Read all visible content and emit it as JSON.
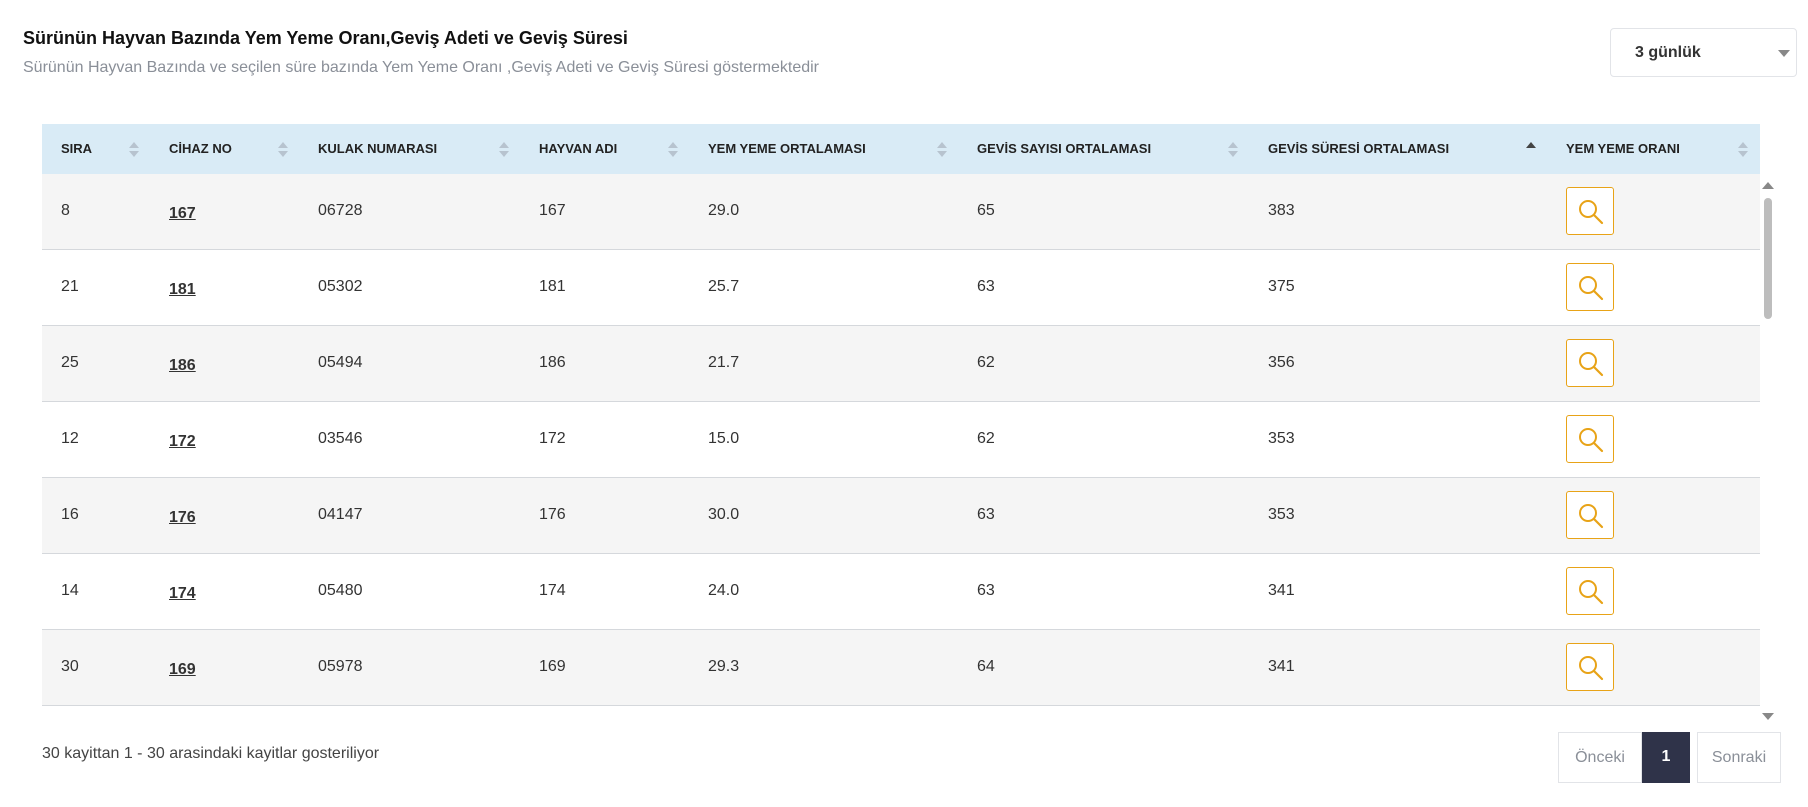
{
  "header": {
    "title": "Sürünün Hayvan Bazında Yem Yeme Oranı,Geviş Adeti ve Geviş Süresi",
    "subtitle": "Sürünün Hayvan Bazında ve seçilen süre bazında Yem Yeme Oranı ,Geviş Adeti ve Geviş Süresi göstermektedir"
  },
  "period_select": {
    "value": "3 günlük"
  },
  "table": {
    "columns": [
      "SIRA",
      "CİHAZ NO",
      "KULAK NUMARASI",
      "HAYVAN ADI",
      "YEM YEME ORTALAMASI",
      "GEVİS SAYISI ORTALAMASI",
      "GEVİS SÜRESİ ORTALAMASI",
      "YEM YEME ORANI"
    ],
    "sorted_column": "GEVİS SÜRESİ ORTALAMASI",
    "rows": [
      {
        "sira": "8",
        "cihaz_no": "167",
        "kulak": "06728",
        "hayvan_adi": "167",
        "yem_ort": "29.0",
        "gevis_sayisi": "65",
        "gevis_suresi": "383"
      },
      {
        "sira": "21",
        "cihaz_no": "181",
        "kulak": "05302",
        "hayvan_adi": "181",
        "yem_ort": "25.7",
        "gevis_sayisi": "63",
        "gevis_suresi": "375"
      },
      {
        "sira": "25",
        "cihaz_no": "186",
        "kulak": "05494",
        "hayvan_adi": "186",
        "yem_ort": "21.7",
        "gevis_sayisi": "62",
        "gevis_suresi": "356"
      },
      {
        "sira": "12",
        "cihaz_no": "172",
        "kulak": "03546",
        "hayvan_adi": "172",
        "yem_ort": "15.0",
        "gevis_sayisi": "62",
        "gevis_suresi": "353"
      },
      {
        "sira": "16",
        "cihaz_no": "176",
        "kulak": "04147",
        "hayvan_adi": "176",
        "yem_ort": "30.0",
        "gevis_sayisi": "63",
        "gevis_suresi": "353"
      },
      {
        "sira": "14",
        "cihaz_no": "174",
        "kulak": "05480",
        "hayvan_adi": "174",
        "yem_ort": "24.0",
        "gevis_sayisi": "63",
        "gevis_suresi": "341"
      },
      {
        "sira": "30",
        "cihaz_no": "169",
        "kulak": "05978",
        "hayvan_adi": "169",
        "yem_ort": "29.3",
        "gevis_sayisi": "64",
        "gevis_suresi": "341"
      }
    ],
    "action_icon": "search-icon",
    "accent_color": "#e8a317"
  },
  "footer": {
    "info": "30 kayittan 1 - 30 arasindaki kayitlar gosteriliyor",
    "prev_label": "Önceki",
    "current_page": "1",
    "next_label": "Sonraki"
  }
}
